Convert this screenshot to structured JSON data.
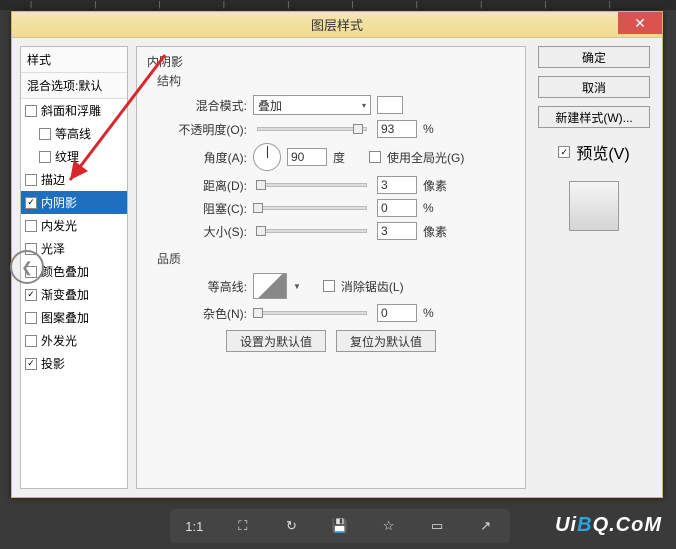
{
  "ruler_ticks": "| | | | | | | | | | |",
  "window": {
    "title": "图层样式",
    "close": "✕"
  },
  "styles_panel": {
    "header": "样式",
    "subheader": "混合选项:默认",
    "items": [
      {
        "label": "斜面和浮雕",
        "checked": false,
        "selected": false,
        "indent": false
      },
      {
        "label": "等高线",
        "checked": false,
        "selected": false,
        "indent": true
      },
      {
        "label": "纹理",
        "checked": false,
        "selected": false,
        "indent": true
      },
      {
        "label": "描边",
        "checked": false,
        "selected": false,
        "indent": false
      },
      {
        "label": "内阴影",
        "checked": true,
        "selected": true,
        "indent": false
      },
      {
        "label": "内发光",
        "checked": false,
        "selected": false,
        "indent": false
      },
      {
        "label": "光泽",
        "checked": false,
        "selected": false,
        "indent": false
      },
      {
        "label": "颜色叠加",
        "checked": false,
        "selected": false,
        "indent": false
      },
      {
        "label": "渐变叠加",
        "checked": true,
        "selected": false,
        "indent": false
      },
      {
        "label": "图案叠加",
        "checked": false,
        "selected": false,
        "indent": false
      },
      {
        "label": "外发光",
        "checked": false,
        "selected": false,
        "indent": false
      },
      {
        "label": "投影",
        "checked": true,
        "selected": false,
        "indent": false
      }
    ]
  },
  "settings": {
    "section_title": "内阴影",
    "group_structure": "结构",
    "blend_mode_label": "混合模式:",
    "blend_mode_value": "叠加",
    "opacity_label": "不透明度(O):",
    "opacity_value": "93",
    "opacity_unit": "%",
    "angle_label": "角度(A):",
    "angle_value": "90",
    "angle_unit": "度",
    "global_light_label": "使用全局光(G)",
    "global_light_checked": false,
    "distance_label": "距离(D):",
    "distance_value": "3",
    "distance_unit": "像素",
    "choke_label": "阻塞(C):",
    "choke_value": "0",
    "choke_unit": "%",
    "size_label": "大小(S):",
    "size_value": "3",
    "size_unit": "像素",
    "group_quality": "品质",
    "contour_label": "等高线:",
    "antialias_label": "消除锯齿(L)",
    "antialias_checked": false,
    "noise_label": "杂色(N):",
    "noise_value": "0",
    "noise_unit": "%",
    "default_btn": "设置为默认值",
    "reset_btn": "复位为默认值"
  },
  "actions": {
    "ok": "确定",
    "cancel": "取消",
    "new_style": "新建样式(W)...",
    "preview_label": "预览(V)",
    "preview_checked": true
  },
  "toolbar": {
    "zoom": "1:1"
  },
  "logo": {
    "pre": "Ui",
    "b": "B",
    "post": "Q.CoM"
  }
}
